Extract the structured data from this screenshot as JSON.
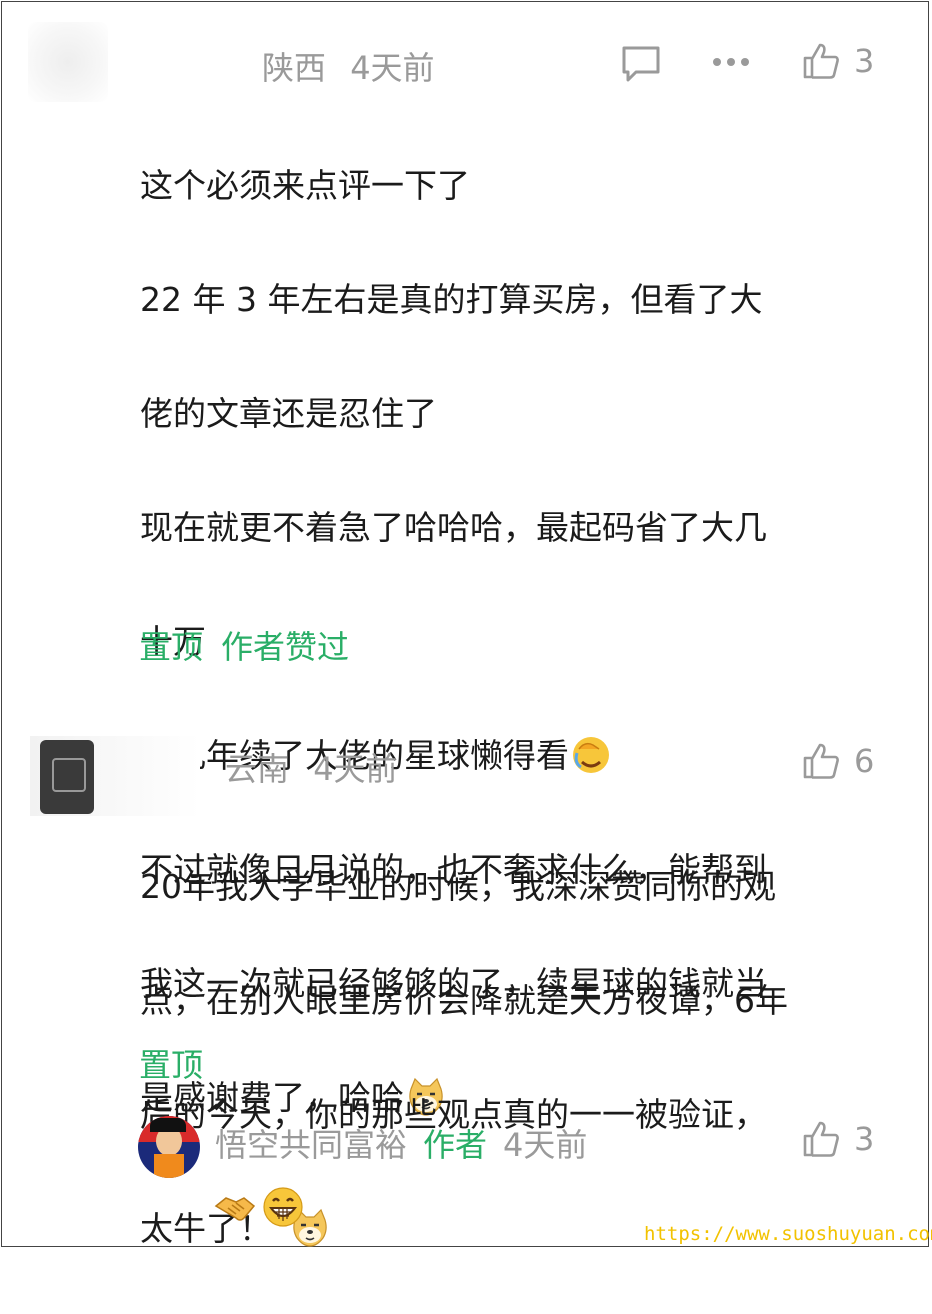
{
  "comments": [
    {
      "location": "陕西",
      "time": "4天前",
      "likes": "3",
      "lines": [
        "这个必须来点评一下了",
        "22 年 3 年左右是真的打算买房，但看了大",
        "佬的文章还是忍住了",
        "现在就更不着急了哈哈哈，最起码省了大几",
        "十万",
        "这几年续了大佬的星球懒得看",
        "不过就像日月说的，也不奢求什么，能帮到",
        "我这一次就已经够够的了，续星球的钱就当",
        "是感谢费了，哈哈"
      ],
      "pinned_label": "置顶",
      "author_liked_label": "作者赞过"
    },
    {
      "location": "云南",
      "time": "4天前",
      "likes": "6",
      "lines": [
        "20年我大学毕业的时候，我深深赞同你的观",
        "点，在别人眼里房价会降就是天方夜谭，6年",
        "后的今天，你的那些观点真的一一被验证，",
        "太牛了！"
      ],
      "pinned_label": "置顶"
    }
  ],
  "reply": {
    "author_name": "悟空共同富裕",
    "author_badge": "作者",
    "time": "4天前",
    "likes": "3"
  },
  "watermark": "https://www.suoshuyuan.com",
  "colors": {
    "green": "#2aae67",
    "meta": "#9a9a9a",
    "watermark": "#f2c200"
  }
}
